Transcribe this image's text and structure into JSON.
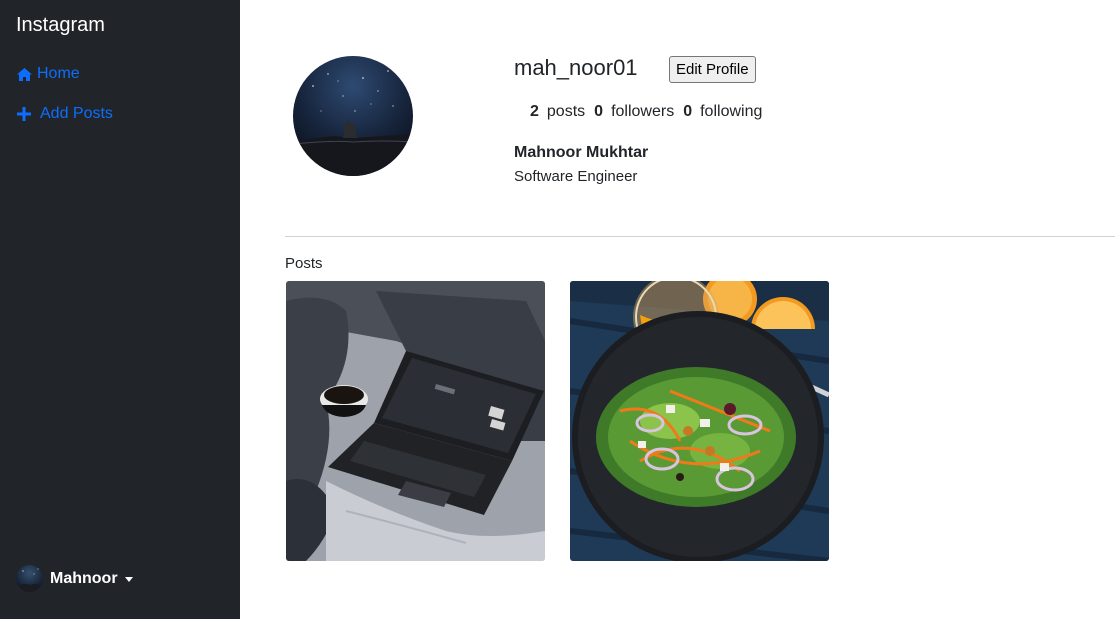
{
  "sidebar": {
    "brand": "Instagram",
    "nav": [
      {
        "label": "Home",
        "icon": "home-icon"
      },
      {
        "label": "Add Posts",
        "icon": "plus-icon"
      }
    ],
    "user": {
      "name": "Mahnoor",
      "avatar": "night-sky-avatar"
    }
  },
  "profile": {
    "username": "mah_noor01",
    "edit_label": "Edit Profile",
    "posts_count": "2",
    "posts_label": "posts",
    "followers_count": "0",
    "followers_label": "followers",
    "following_count": "0",
    "following_label": "following",
    "full_name": "Mahnoor Mukhtar",
    "bio": "Software Engineer"
  },
  "posts": {
    "heading": "Posts",
    "items": [
      {
        "image": "laptop-on-bed-photo"
      },
      {
        "image": "salad-and-orange-juice-photo"
      }
    ]
  },
  "colors": {
    "sidebar_bg": "#212529",
    "link": "#0d6efd"
  }
}
